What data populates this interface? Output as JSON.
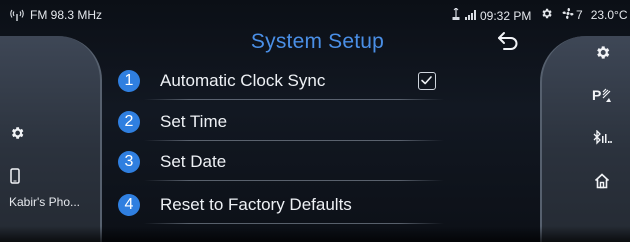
{
  "status_bar": {
    "radio": "FM 98.3 MHz",
    "time": "09:32 PM",
    "fan_speed": "7",
    "temperature": "23.0°C"
  },
  "header": {
    "title": "System Setup"
  },
  "menu": {
    "items": [
      {
        "number": "1",
        "label": "Automatic Clock Sync",
        "checked": true
      },
      {
        "number": "2",
        "label": "Set Time"
      },
      {
        "number": "3",
        "label": "Set Date"
      },
      {
        "number": "4",
        "label": "Reset to Factory Defaults"
      }
    ]
  },
  "left_panel": {
    "phone_label": "Kabir's Pho..."
  },
  "icons": {
    "left": [
      "gear-icon",
      "phone-icon"
    ],
    "right": [
      "gear-icon",
      "parking-sensor-icon",
      "bluetooth-icon",
      "home-icon"
    ]
  },
  "colors": {
    "accent": "#4a8fe6",
    "badge": "#2f7fe0",
    "background": "#0b0f16",
    "panel": "#2f3743"
  }
}
